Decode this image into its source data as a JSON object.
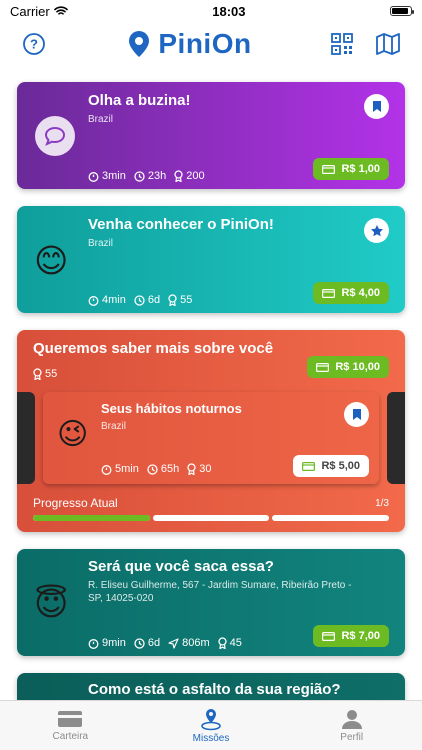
{
  "status_bar": {
    "carrier": "Carrier",
    "time": "18:03"
  },
  "header": {
    "logo_text": "PiniOn"
  },
  "cards": [
    {
      "title": "Olha a buzina!",
      "subtitle": "Brazil",
      "duration": "3min",
      "expires": "23h",
      "points": "200",
      "price": "R$ 1,00",
      "colors": {
        "from": "#6e2c9b",
        "to": "#b233e6"
      }
    },
    {
      "title": "Venha conhecer o PiniOn!",
      "subtitle": "Brazil",
      "duration": "4min",
      "expires": "6d",
      "points": "55",
      "price": "R$ 4,00",
      "colors": {
        "from": "#10a3a0",
        "to": "#1ec8c4"
      }
    },
    {
      "title": "Queremos saber mais sobre você",
      "points": "55",
      "price": "R$ 10,00",
      "inner": {
        "title": "Seus hábitos noturnos",
        "subtitle": "Brazil",
        "duration": "5min",
        "expires": "65h",
        "points": "30",
        "price": "R$ 5,00"
      },
      "progress_label": "Progresso Atual",
      "progress_count": "1/3",
      "progress_value": 0.333,
      "colors": {
        "from": "#d9533d",
        "to": "#f36b4a"
      }
    },
    {
      "title": "Será que você saca essa?",
      "subtitle": "R. Eliseu Guilherme, 567 - Jardim Sumare, Ribeirão Preto - SP, 14025-020",
      "duration": "9min",
      "expires": "6d",
      "distance": "806m",
      "points": "45",
      "price": "R$ 7,00",
      "colors": {
        "from": "#0c6f6a",
        "to": "#11837d"
      }
    },
    {
      "title": "Como está o asfalto da sua região?",
      "colors": {
        "from": "#0c5e5a",
        "to": "#0f6e68"
      }
    }
  ],
  "tabs": [
    {
      "label": "Carteira",
      "active": false
    },
    {
      "label": "Missões",
      "active": true
    },
    {
      "label": "Perfil",
      "active": false
    }
  ]
}
